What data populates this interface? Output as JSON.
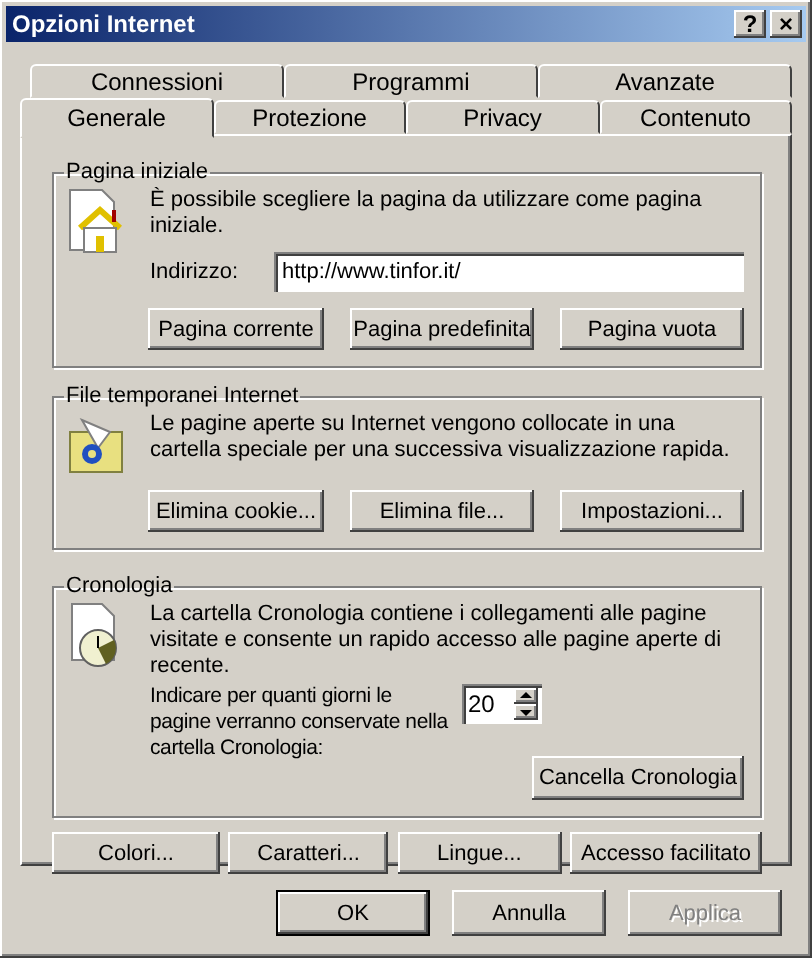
{
  "window": {
    "title": "Opzioni Internet",
    "title_buttons": [
      {
        "kind": "help",
        "label": "?"
      },
      {
        "kind": "close",
        "label": "×"
      }
    ]
  },
  "tab_rows": [
    [
      {
        "label": "Connessioni",
        "selected": false
      },
      {
        "label": "Programmi",
        "selected": false
      },
      {
        "label": "Avanzate",
        "selected": false
      }
    ],
    [
      {
        "label": "Generale",
        "selected": true
      },
      {
        "label": "Protezione",
        "selected": false
      },
      {
        "label": "Privacy",
        "selected": false
      },
      {
        "label": "Contenuto",
        "selected": false
      }
    ]
  ],
  "home_page": {
    "title": "Pagina iniziale",
    "description": "È possibile scegliere la pagina da utilizzare come pagina iniziale.",
    "address_label": "Indirizzo:",
    "address": "http://www.tinfor.it/",
    "buttons": [
      "Pagina corrente",
      "Pagina predefinita",
      "Pagina vuota"
    ]
  },
  "temp_files": {
    "title": "File temporanei Internet",
    "description": "Le pagine aperte su Internet vengono collocate in una cartella speciale per una successiva visualizzazione rapida.",
    "buttons": [
      "Elimina cookie...",
      "Elimina file...",
      "Impostazioni..."
    ]
  },
  "history": {
    "title": "Cronologia",
    "description": "La cartella Cronologia contiene i collegamenti alle pagine visitate e consente un rapido accesso alle pagine aperte di recente.",
    "days_label": "Indicare per quanti giorni le pagine verranno conservate nella cartella Cronologia:",
    "days": "20",
    "clear_button": "Cancella Cronologia"
  },
  "bottom_buttons": [
    "Colori...",
    "Caratteri...",
    "Lingue...",
    "Accesso facilitato"
  ],
  "dialog_buttons": [
    {
      "label": "OK",
      "default": true,
      "disabled": false
    },
    {
      "label": "Annulla",
      "default": false,
      "disabled": false
    },
    {
      "label": "Applica",
      "default": false,
      "disabled": true
    }
  ]
}
